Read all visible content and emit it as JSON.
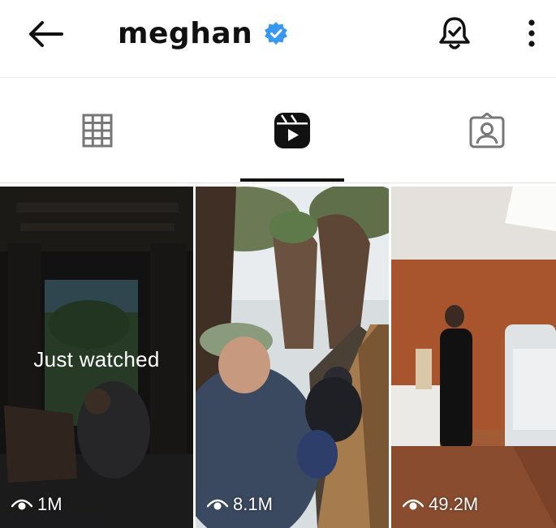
{
  "header": {
    "username": "meghan",
    "verified": true,
    "accent_color": "#3897f0"
  },
  "icons": {
    "back": "arrow-left-icon",
    "verified": "verified-badge-icon",
    "bell": "notification-bell-icon",
    "more": "more-vertical-icon",
    "grid": "grid-icon",
    "reels": "reels-icon",
    "tagged": "tagged-icon",
    "eye": "eye-icon"
  },
  "tabs": {
    "active": "reels"
  },
  "reels": [
    {
      "views": "1M",
      "overlay": "Just watched"
    },
    {
      "views": "8.1M"
    },
    {
      "views": "49.2M"
    }
  ]
}
